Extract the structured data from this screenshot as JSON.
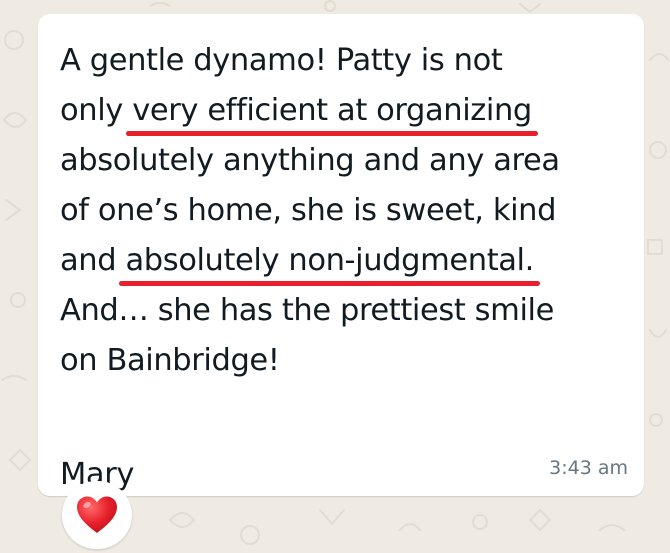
{
  "message": {
    "lines": [
      {
        "pre": "A gentle dynamo! Patty is not",
        "mark": "",
        "post": ""
      },
      {
        "pre": "only ",
        "mark": "very efficient at organizing",
        "post": ""
      },
      {
        "pre": "absolutely anything and any area",
        "mark": "",
        "post": ""
      },
      {
        "pre": "of one’s home, she is sweet, kind",
        "mark": "",
        "post": ""
      },
      {
        "pre": "and ",
        "mark": "absolutely non-judgmental.",
        "post": ""
      },
      {
        "pre": "And… she has the prettiest smile",
        "mark": "",
        "post": ""
      },
      {
        "pre": "on Bainbridge!",
        "mark": "",
        "post": ""
      }
    ],
    "signature": "Mary",
    "time": "3:43 am",
    "reaction": {
      "emoji_name": "red-heart-icon",
      "color": "#e8202b"
    }
  },
  "colors": {
    "wallpaper": "#efeae2",
    "bubble": "#ffffff",
    "text": "#111b21",
    "time": "#667781",
    "underline": "#e8202b"
  }
}
